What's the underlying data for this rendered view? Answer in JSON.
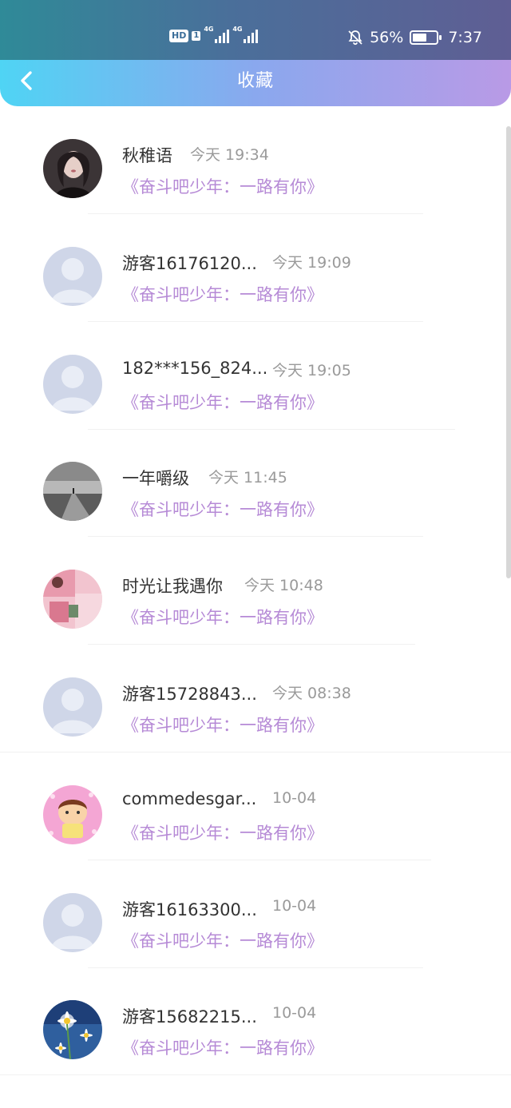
{
  "status_bar": {
    "hd_label": "HD",
    "sim_label": "1",
    "net_1": "4G",
    "net_2": "4G",
    "battery": "56%",
    "time": "7:37",
    "icons": [
      "bell-off-icon",
      "battery-icon",
      "signal-icon"
    ]
  },
  "header": {
    "title": "收藏",
    "back_icon": "chevron-left-icon"
  },
  "items": [
    {
      "name": "秋稚语",
      "time": "今天 19:34",
      "title": "《奋斗吧少年：一路有你》",
      "avatar": "photo-girl"
    },
    {
      "name": "游客16176120...",
      "time": "今天 19:09",
      "title": "《奋斗吧少年：一路有你》",
      "avatar": "default"
    },
    {
      "name": "182***156_824...",
      "time": "今天 19:05",
      "title": "《奋斗吧少年：一路有你》",
      "avatar": "default"
    },
    {
      "name": "一年嚼级",
      "time": "今天 11:45",
      "title": "《奋斗吧少年：一路有你》",
      "avatar": "photo-pier"
    },
    {
      "name": "时光让我遇你",
      "time": "今天 10:48",
      "title": "《奋斗吧少年：一路有你》",
      "avatar": "photo-pink"
    },
    {
      "name": "游客15728843...",
      "time": "今天 08:38",
      "title": "《奋斗吧少年：一路有你》",
      "avatar": "default"
    },
    {
      "name": "commedesgar...",
      "time": "10-04",
      "title": "《奋斗吧少年：一路有你》",
      "avatar": "cartoon"
    },
    {
      "name": "游客16163300...",
      "time": "10-04",
      "title": "《奋斗吧少年：一路有你》",
      "avatar": "default"
    },
    {
      "name": "游客15682215...",
      "time": "10-04",
      "title": "《奋斗吧少年：一路有你》",
      "avatar": "photo-daisy"
    }
  ],
  "colors": {
    "name": "#333333",
    "time": "#9a9a9a",
    "title": "#b68ad6",
    "default_avatar": "#cfd6e8"
  }
}
